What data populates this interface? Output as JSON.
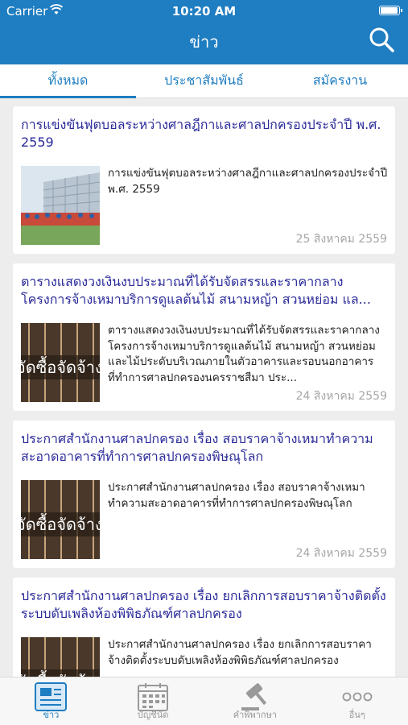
{
  "status": {
    "carrier": "Carrier",
    "time": "10:20 AM",
    "battery_level": 1.0
  },
  "header": {
    "title": "ข่าว",
    "search_icon": "search-icon"
  },
  "tabs": [
    {
      "label": "ทั้งหมด",
      "active": true
    },
    {
      "label": "ประชาสัมพันธ์",
      "active": false
    },
    {
      "label": "สมัครงาน",
      "active": false
    }
  ],
  "news": [
    {
      "title": "การแข่งขันฟุตบอลระหว่างศาลฎีกาและศาลปกครองประจำปี พ.ศ. 2559",
      "summary": "การแข่งขันฟุตบอลระหว่างศาลฎีกาและศาลปกครองประจำปี พ.ศ. 2559",
      "date": "25 สิงหาคม 2559"
    },
    {
      "title": "ตารางแสดงวงเงินงบประมาณที่ได้รับจัดสรรและราคากลาง โครงการจ้างเหมาบริการดูแลต้นไม้ สนามหญ้า สวนหย่อม แล...",
      "summary": "ตารางแสดงวงเงินงบประมาณที่ได้รับจัดสรรและราคากลาง โครงการจ้างเหมาบริการดูแลต้นไม้ สนามหญ้า สวนหย่อม และไม้ประดับบริเวณภายในตัวอาคารและรอบนอกอาคารที่ทำการศาลปกครองนครราชสีมา ประ...",
      "date": "24 สิงหาคม 2559"
    },
    {
      "title": "ประกาศสำนักงานศาลปกครอง เรื่อง สอบราคาจ้างเหมาทำความสะอาดอาคารที่ทำการศาลปกครองพิษณุโลก",
      "summary": "ประกาศสำนักงานศาลปกครอง เรื่อง สอบราคาจ้างเหมาทำความสะอาดอาคารที่ทำการศาลปกครองพิษณุโลก",
      "date": "24 สิงหาคม 2559"
    },
    {
      "title": "ประกาศสำนักงานศาลปกครอง เรื่อง ยกเลิกการสอบราคาจ้างติดตั้งระบบดับเพลิงห้องพิพิธภัณฑ์ศาลปกครอง",
      "summary": "ประกาศสำนักงานศาลปกครอง เรื่อง ยกเลิกการสอบราคาจ้างติดตั้งระบบดับเพลิงห้องพิพิธภัณฑ์ศาลปกครอง",
      "date": ""
    }
  ],
  "thumb_overlay_text": "จัดซื้อจัดจ้าง",
  "tabbar": [
    {
      "label": "ข่าว",
      "icon": "newspaper-icon",
      "active": true
    },
    {
      "label": "บัญชีนัด",
      "icon": "calendar-icon",
      "active": false
    },
    {
      "label": "คำพิพากษา",
      "icon": "gavel-icon",
      "active": false
    },
    {
      "label": "อื่นๆ",
      "icon": "more-icon",
      "active": false
    }
  ],
  "colors": {
    "primary": "#1f7dc1",
    "title": "#2a2a9a",
    "date": "#a7a7a7"
  }
}
